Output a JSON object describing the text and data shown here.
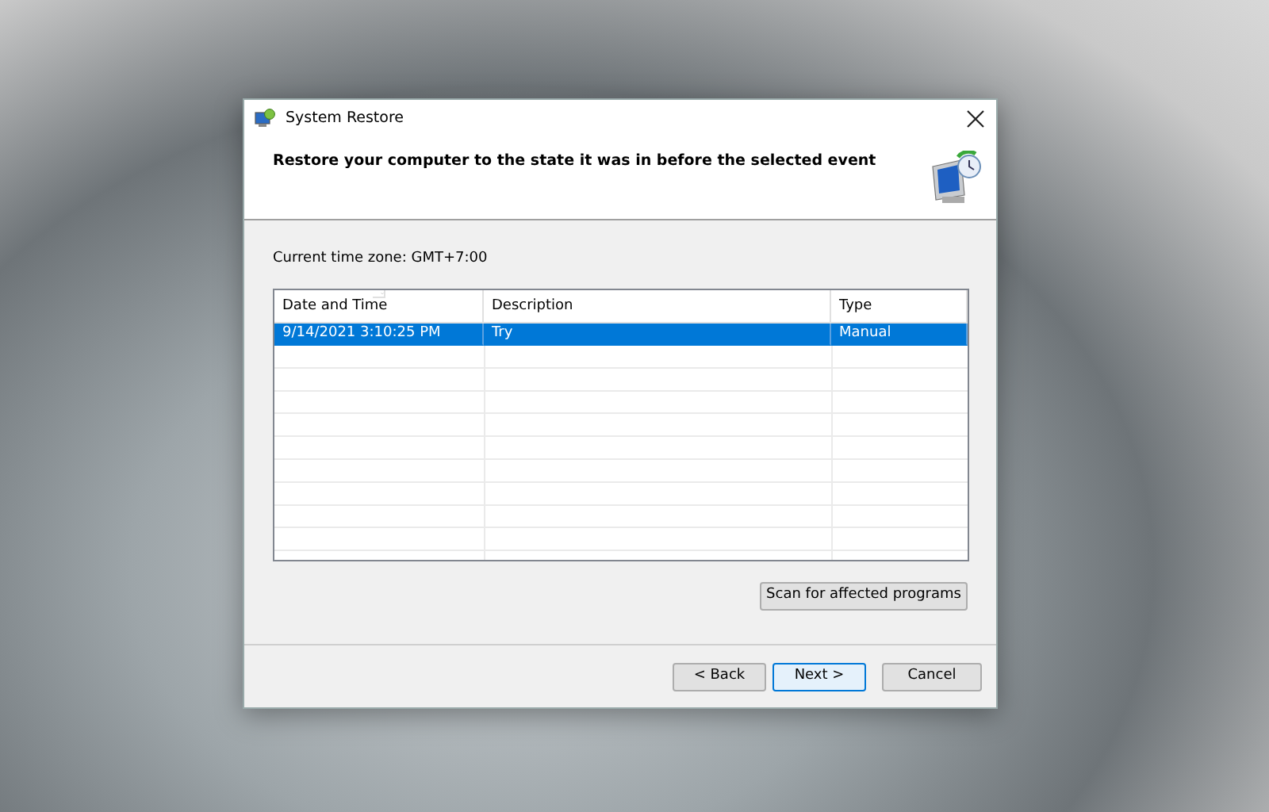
{
  "window": {
    "title": "System Restore"
  },
  "heading": "Restore your computer to the state it was in before the selected event",
  "time_zone": "Current time zone: GMT+7:00",
  "table": {
    "columns": [
      {
        "label": "Date and Time",
        "sorted": true
      },
      {
        "label": "Description",
        "sorted": false
      },
      {
        "label": "Type",
        "sorted": false
      }
    ],
    "rows": [
      {
        "cells": [
          "9/14/2021 3:10:25 PM",
          "Try",
          "Manual"
        ],
        "selected": true
      }
    ]
  },
  "scan_button": "Scan for affected programs",
  "buttons": [
    {
      "label": "< Back",
      "default": false
    },
    {
      "label": "Next >",
      "default": true
    },
    {
      "label": "Cancel",
      "default": false
    }
  ]
}
